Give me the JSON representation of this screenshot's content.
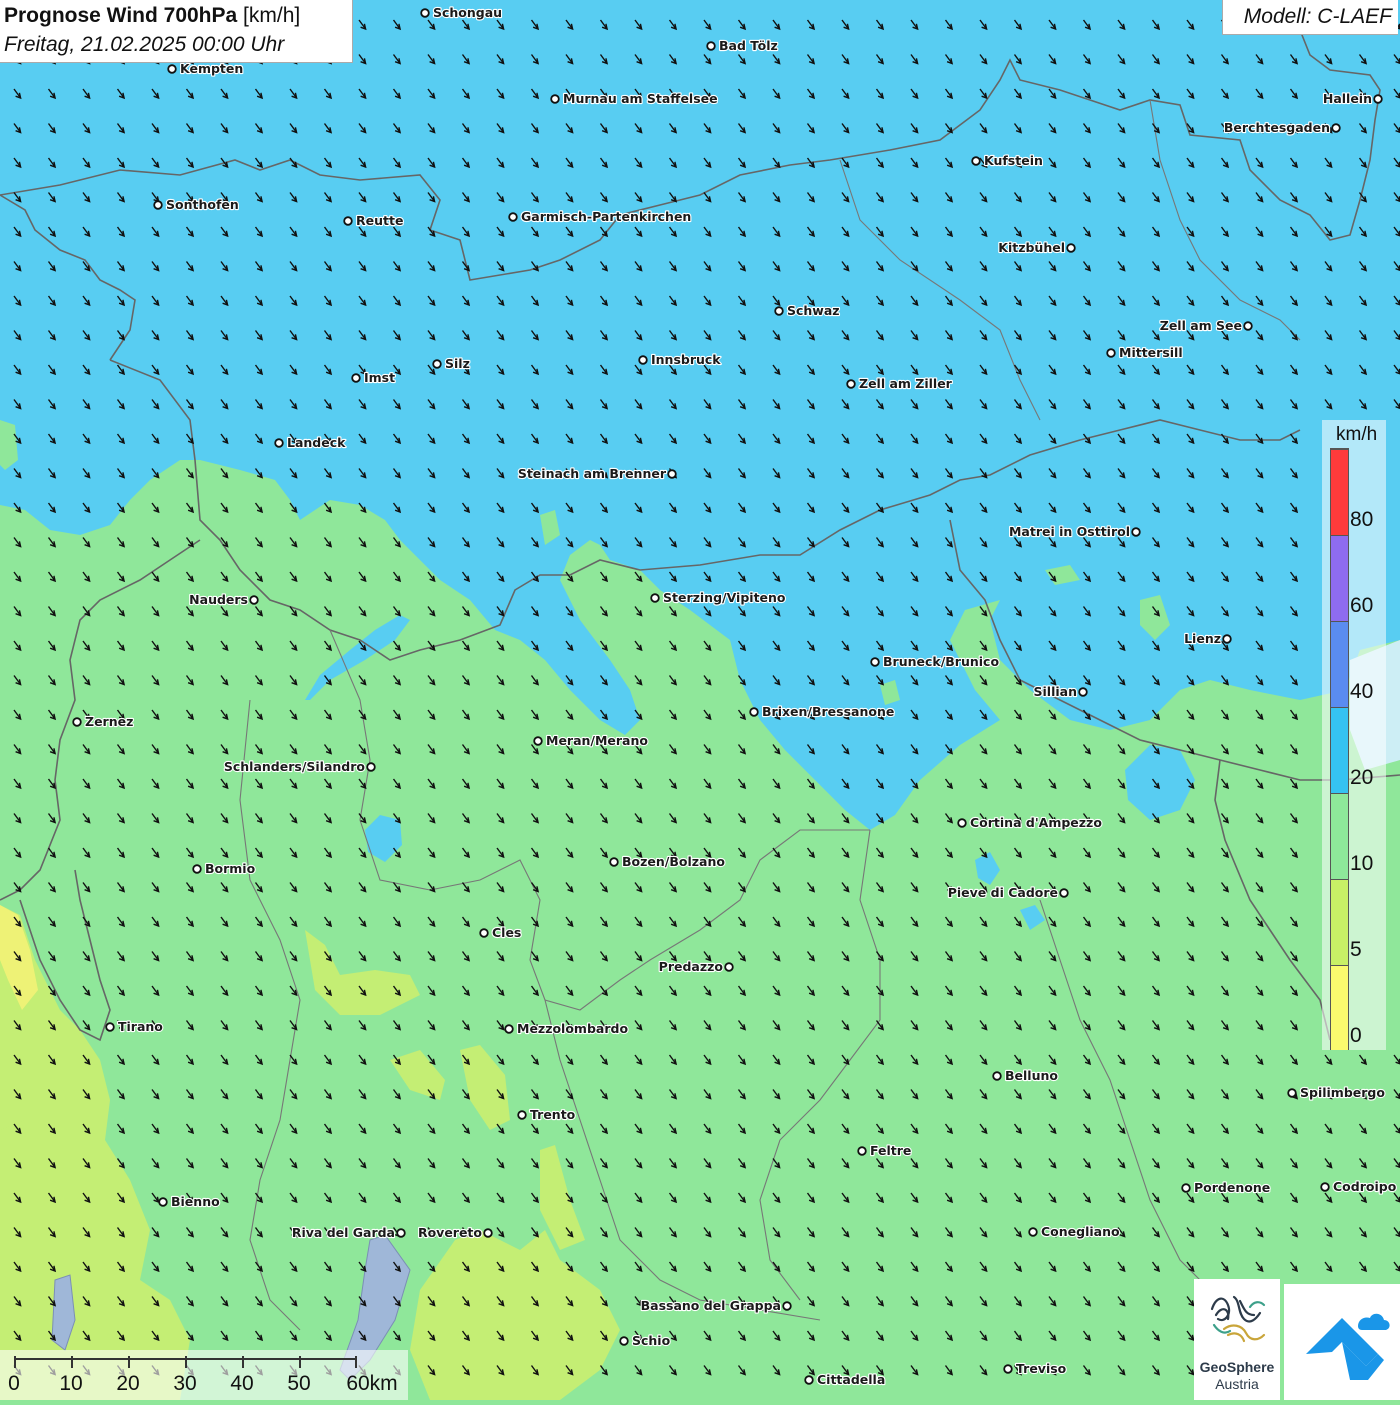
{
  "title": {
    "main": "Prognose Wind 700hPa",
    "unit": "[km/h]",
    "date": "Freitag, 21.02.2025 00:00 Uhr"
  },
  "model": "Modell: C-LAEF",
  "legend": {
    "unit": "km/h",
    "ticks": [
      "80",
      "60",
      "40",
      "20",
      "10",
      "5",
      "0"
    ],
    "colors": [
      "#ff3b3b",
      "#8e6cf0",
      "#5a8cf0",
      "#35c3f2",
      "#8ee89a",
      "#c8f066",
      "#fafa6e"
    ]
  },
  "scale": {
    "labels": [
      "0",
      "10",
      "20",
      "30",
      "40",
      "50",
      "60km"
    ]
  },
  "logo": {
    "name": "GeoSphere",
    "sub": "Austria"
  },
  "cities": [
    {
      "name": "Schongau",
      "label_side": "right"
    },
    {
      "name": "Bad Tölz",
      "label_side": "right"
    },
    {
      "name": "Kempten",
      "label_side": "right"
    },
    {
      "name": "Murnau am Staffelsee",
      "label_side": "right"
    },
    {
      "name": "Hallein",
      "label_side": "left"
    },
    {
      "name": "Berchtesgaden",
      "label_side": "left"
    },
    {
      "name": "Kufstein",
      "label_side": "right"
    },
    {
      "name": "Sonthofen",
      "label_side": "right"
    },
    {
      "name": "Reutte",
      "label_side": "right"
    },
    {
      "name": "Garmisch-Partenkirchen",
      "label_side": "right"
    },
    {
      "name": "Kitzbühel",
      "label_side": "left"
    },
    {
      "name": "Schwaz",
      "label_side": "right"
    },
    {
      "name": "Zell am See",
      "label_side": "left"
    },
    {
      "name": "Innsbruck",
      "label_side": "right"
    },
    {
      "name": "Mittersill",
      "label_side": "right"
    },
    {
      "name": "Silz",
      "label_side": "right"
    },
    {
      "name": "Imst",
      "label_side": "right"
    },
    {
      "name": "Zell am Ziller",
      "label_side": "right"
    },
    {
      "name": "Landeck",
      "label_side": "right"
    },
    {
      "name": "Steinach am Brenner",
      "label_side": "left"
    },
    {
      "name": "Matrei in Osttirol",
      "label_side": "left"
    },
    {
      "name": "Nauders",
      "label_side": "left"
    },
    {
      "name": "Sterzing/Vipiteno",
      "label_side": "right"
    },
    {
      "name": "Lienz",
      "label_side": "left"
    },
    {
      "name": "Bruneck/Brunico",
      "label_side": "right"
    },
    {
      "name": "Sillian",
      "label_side": "left"
    },
    {
      "name": "Brixen/Bressanone",
      "label_side": "right"
    },
    {
      "name": "Zernez",
      "label_side": "right"
    },
    {
      "name": "Meran/Merano",
      "label_side": "right"
    },
    {
      "name": "Schlanders/Silandro",
      "label_side": "left"
    },
    {
      "name": "Cortina d'Ampezzo",
      "label_side": "right"
    },
    {
      "name": "Bozen/Bolzano",
      "label_side": "right"
    },
    {
      "name": "Bormio",
      "label_side": "right"
    },
    {
      "name": "Pieve di Cadore",
      "label_side": "left"
    },
    {
      "name": "Cles",
      "label_side": "right"
    },
    {
      "name": "Predazzo",
      "label_side": "left"
    },
    {
      "name": "Tirano",
      "label_side": "right"
    },
    {
      "name": "Mezzolombardo",
      "label_side": "right"
    },
    {
      "name": "Belluno",
      "label_side": "right"
    },
    {
      "name": "Spilimbergo",
      "label_side": "right"
    },
    {
      "name": "Trento",
      "label_side": "right"
    },
    {
      "name": "Feltre",
      "label_side": "right"
    },
    {
      "name": "Pordenone",
      "label_side": "right"
    },
    {
      "name": "Codroipo",
      "label_side": "right"
    },
    {
      "name": "Bienno",
      "label_side": "right"
    },
    {
      "name": "Riva del Garda",
      "label_side": "left"
    },
    {
      "name": "Rovereto",
      "label_side": "left"
    },
    {
      "name": "Conegliano",
      "label_side": "right"
    },
    {
      "name": "Bassano del Grappa",
      "label_side": "left"
    },
    {
      "name": "Schio",
      "label_side": "right"
    },
    {
      "name": "Treviso",
      "label_side": "right"
    },
    {
      "name": "Cittadella",
      "label_side": "right"
    }
  ]
}
